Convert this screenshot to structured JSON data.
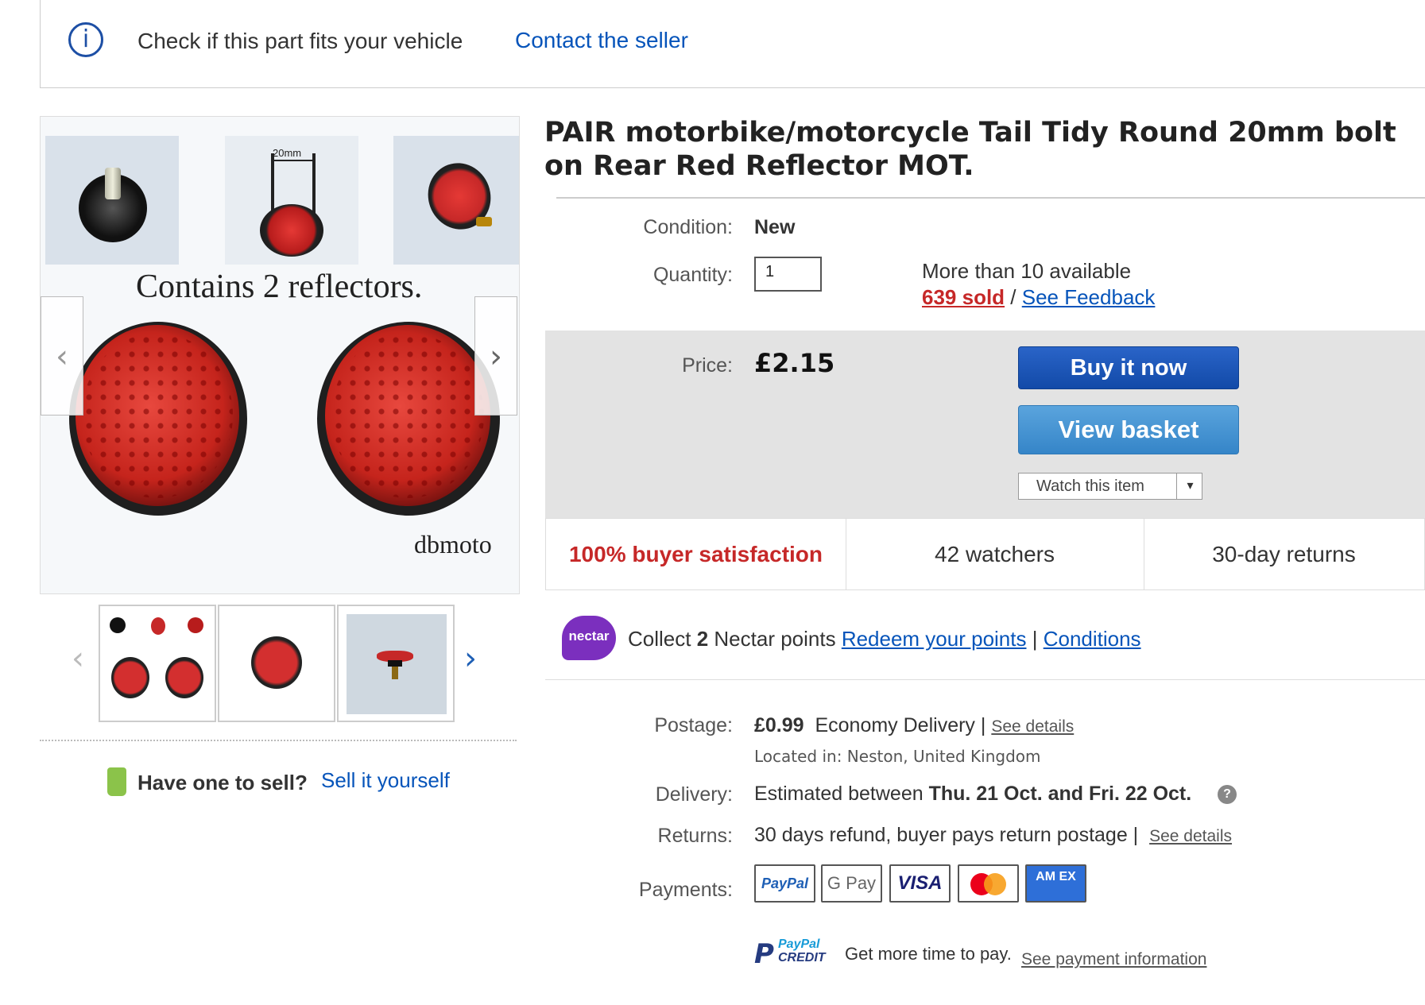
{
  "banner": {
    "info_icon": "info-icon",
    "check_text": "Check if this part fits your vehicle",
    "contact_link": "Contact the seller"
  },
  "gallery": {
    "caption": "Contains 2 reflectors.",
    "brand": "dbmoto",
    "dimension_label": "20mm",
    "prev_icon": "chevron-left-icon",
    "next_icon": "chevron-right-icon"
  },
  "sell": {
    "question": "Have one to sell?",
    "link": "Sell it yourself"
  },
  "listing": {
    "title": "PAIR motorbike/motorcycle Tail Tidy Round 20mm bolt on Rear Red Reflector MOT.",
    "condition_label": "Condition:",
    "condition_value": "New",
    "quantity_label": "Quantity:",
    "quantity_value": "1",
    "availability": "More than 10 available",
    "sold": "639 sold",
    "sold_sep": " / ",
    "feedback_link": "See Feedback",
    "price_label": "Price:",
    "price_value": "£2.15",
    "buy_button": "Buy it now",
    "basket_button": "View basket",
    "watch_button": "Watch this item"
  },
  "stats": {
    "satisfaction": "100% buyer satisfaction",
    "watchers": "42 watchers",
    "returns": "30-day returns"
  },
  "nectar": {
    "logo": "nectar",
    "collect_prefix": "Collect ",
    "points": "2",
    "collect_suffix": " Nectar points ",
    "redeem_link": "Redeem your points",
    "sep": " | ",
    "conditions_link": "Conditions"
  },
  "shipping": {
    "postage_label": "Postage:",
    "postage_price": "£0.99",
    "postage_service": "Economy Delivery |",
    "postage_details": "See details",
    "located": "Located in:  Neston, United Kingdom",
    "delivery_label": "Delivery:",
    "delivery_prefix": "Estimated between ",
    "delivery_dates": "Thu. 21 Oct. and Fri. 22 Oct.",
    "returns_label": "Returns:",
    "returns_text": "30 days refund, buyer pays return postage |",
    "returns_details": "See details",
    "payments_label": "Payments:",
    "payment_methods": [
      "PayPal",
      "G Pay",
      "VISA",
      "",
      "AM EX"
    ],
    "paypal_credit_logo": [
      "PayPal",
      "CREDIT"
    ],
    "paypal_text": "Get more time to pay.",
    "paypal_link": "See payment information"
  },
  "colors": {
    "link": "#0654ba",
    "buy": "#124aa8",
    "basket": "#3585c8",
    "sold": "#c62828"
  }
}
